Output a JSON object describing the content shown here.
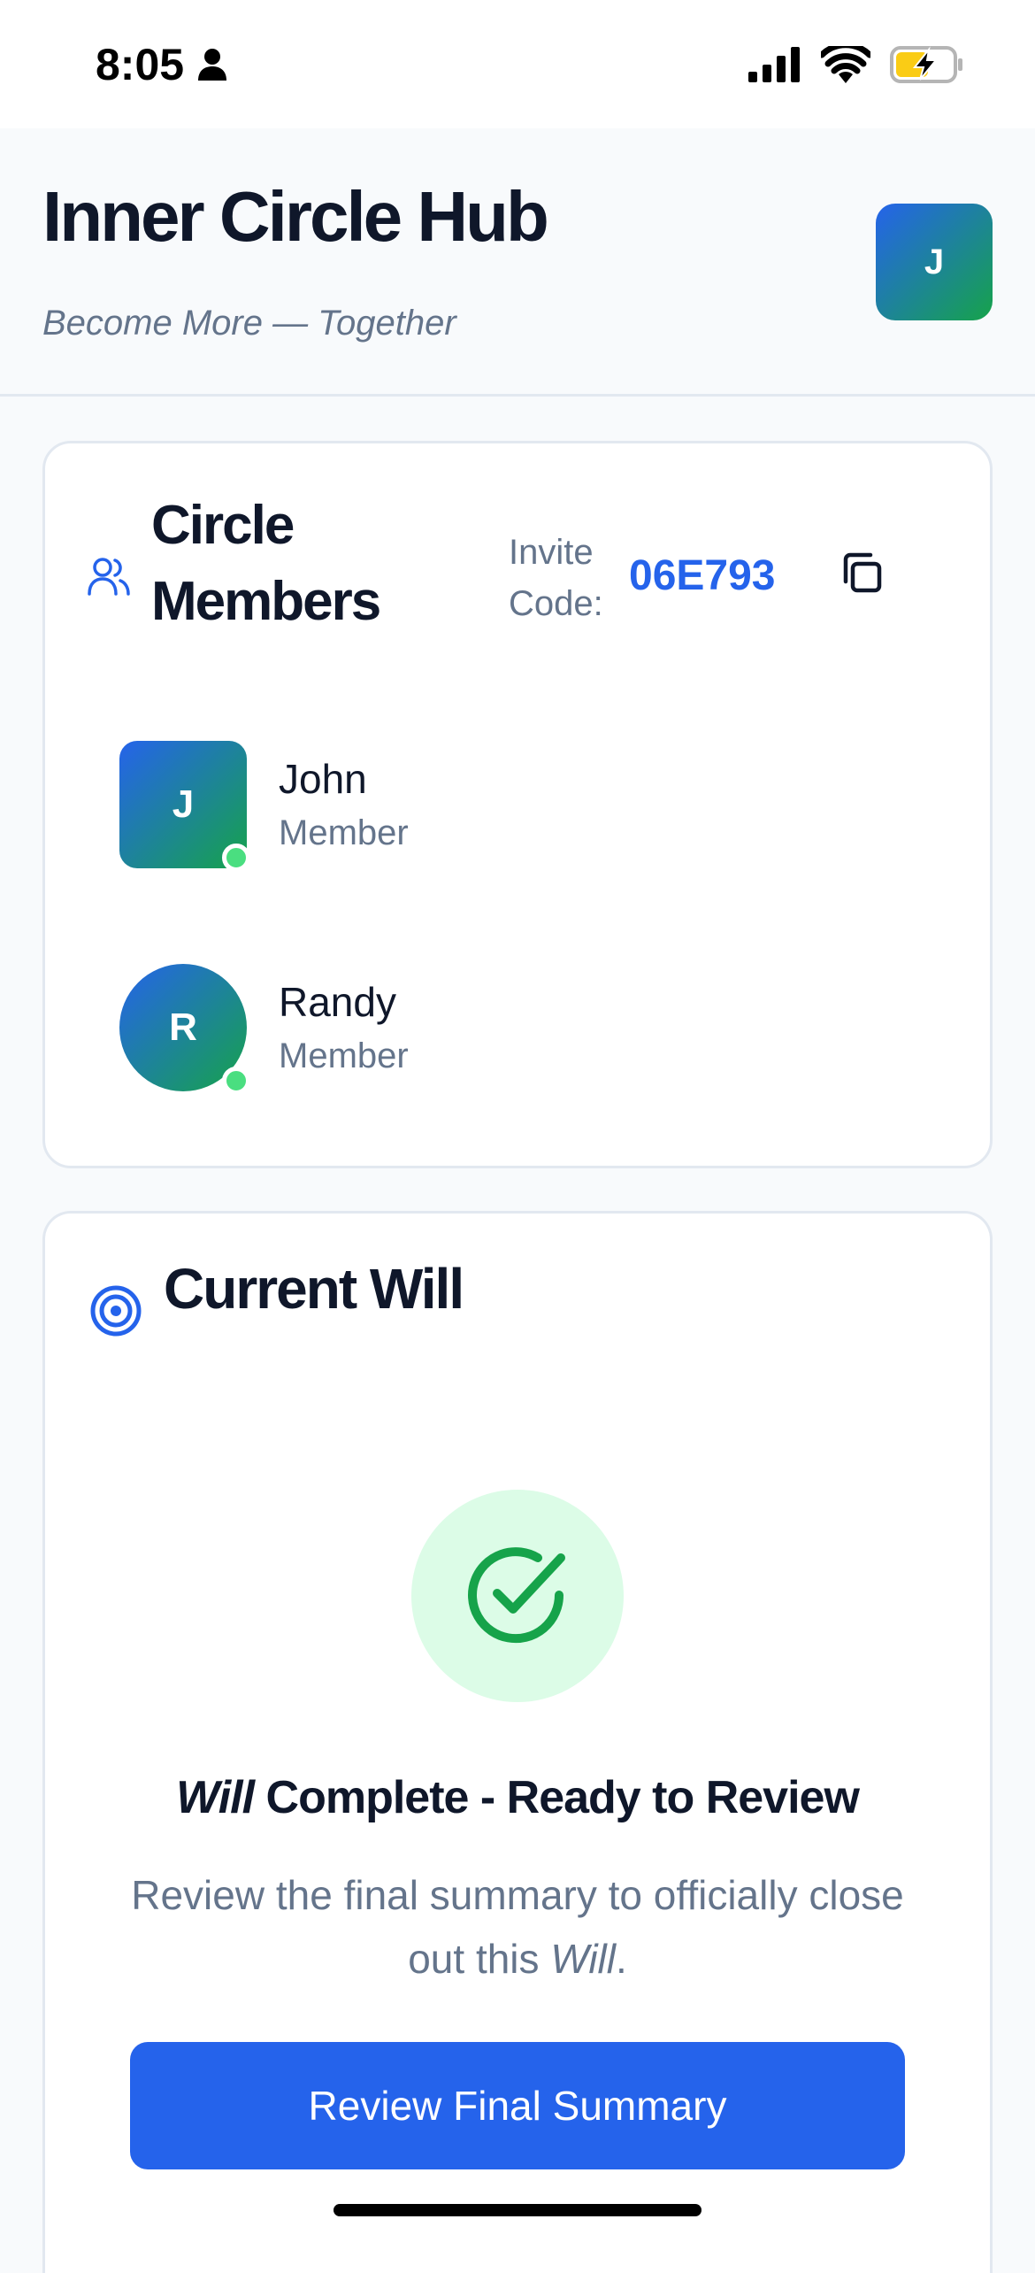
{
  "status_bar": {
    "time": "8:05"
  },
  "header": {
    "title": "Inner Circle Hub",
    "tagline": "Become More — Together",
    "avatar_initial": "J"
  },
  "members_card": {
    "title": "Circle Members",
    "invite_label": "Invite Code:",
    "invite_code": "06E793",
    "members": [
      {
        "initial": "J",
        "name": "John",
        "role": "Member",
        "online": true
      },
      {
        "initial": "R",
        "name": "Randy",
        "role": "Member",
        "online": true
      }
    ]
  },
  "will_card": {
    "title": "Current Will",
    "status_heading_em": "Will",
    "status_heading_rest": " Complete - Ready to Review",
    "description_pre": "Review the final summary to officially close out this ",
    "description_em": "Will",
    "description_post": ".",
    "review_button_label": "Review Final Summary"
  },
  "colors": {
    "accent": "#2563eb",
    "success": "#16a34a",
    "success_bg": "#dcfce7",
    "online": "#4ade80"
  }
}
